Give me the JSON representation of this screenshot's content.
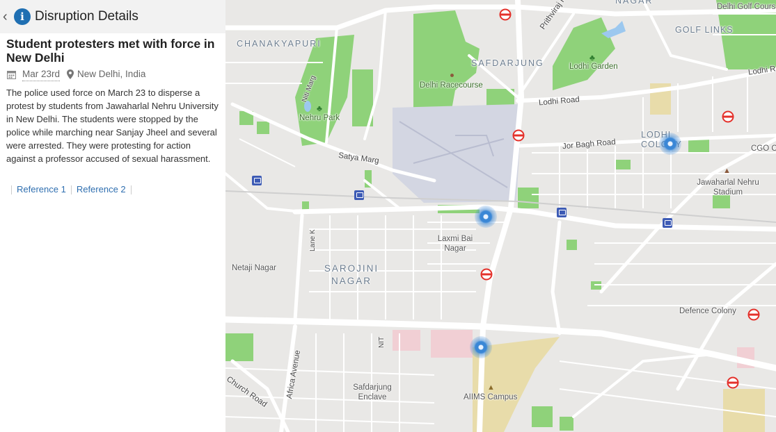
{
  "panel": {
    "title": "Disruption Details",
    "event_title": "Student protesters met with force in New Delhi",
    "date": "Mar 23rd",
    "location": "New Delhi, India",
    "description": "The police used force on March 23 to disperse a protest by students from Jawaharlal Nehru University in New Delhi. The students were stopped by the police while marching near Sanjay Jheel and several were arrested. They were protesting for action against a professor accused of sexual harassment.",
    "references": [
      "Reference 1",
      "Reference 2"
    ]
  },
  "map": {
    "labels": {
      "chanakyapuri": "CHANAKYAPURI",
      "safdarjung": "SAFDARJUNG",
      "golf_links": "GOLF LINKS",
      "nagar": "NAGAR",
      "delhi_golf": "Delhi Golf Cours",
      "prithviraj": "Prithviraj Road",
      "lodhi_garden": "Lodhi Garden",
      "lodhi_road": "Lodhi Road",
      "lodhi_road2": "Lodhi R",
      "racecourse": "Delhi Racecourse",
      "niti_marg": "Niti Marg",
      "nehru_park": "Nehru Park",
      "jor_bagh": "Jor Bagh Road",
      "lodhi_colony": "LODHI COLONY",
      "cgo": "CGO Co",
      "satya_marg": "Satya Marg",
      "jn_stadium": "Jawaharlal Nehru Stadium",
      "laxmi_bai": "Laxmi Bai Nagar",
      "lane_k": "Lane K",
      "netaji": "Netaji Nagar",
      "sarojini": "SAROJINI NAGAR",
      "defence": "Defence Colony",
      "nit": "NIT",
      "africa": "Africa Avenue",
      "church": "Church Road",
      "safdarjung_enclave": "Safdarjung Enclave",
      "aiims": "AIIMS Campus"
    },
    "colors": {
      "land": "#e9e8e6",
      "park": "#8fd27a",
      "road": "#ffffff",
      "airport": "#d3d6e2",
      "campus": "#e8dcaa",
      "marker": "#3a87d6",
      "metro": "#e4312b",
      "bus": "#3d5bb5"
    }
  }
}
